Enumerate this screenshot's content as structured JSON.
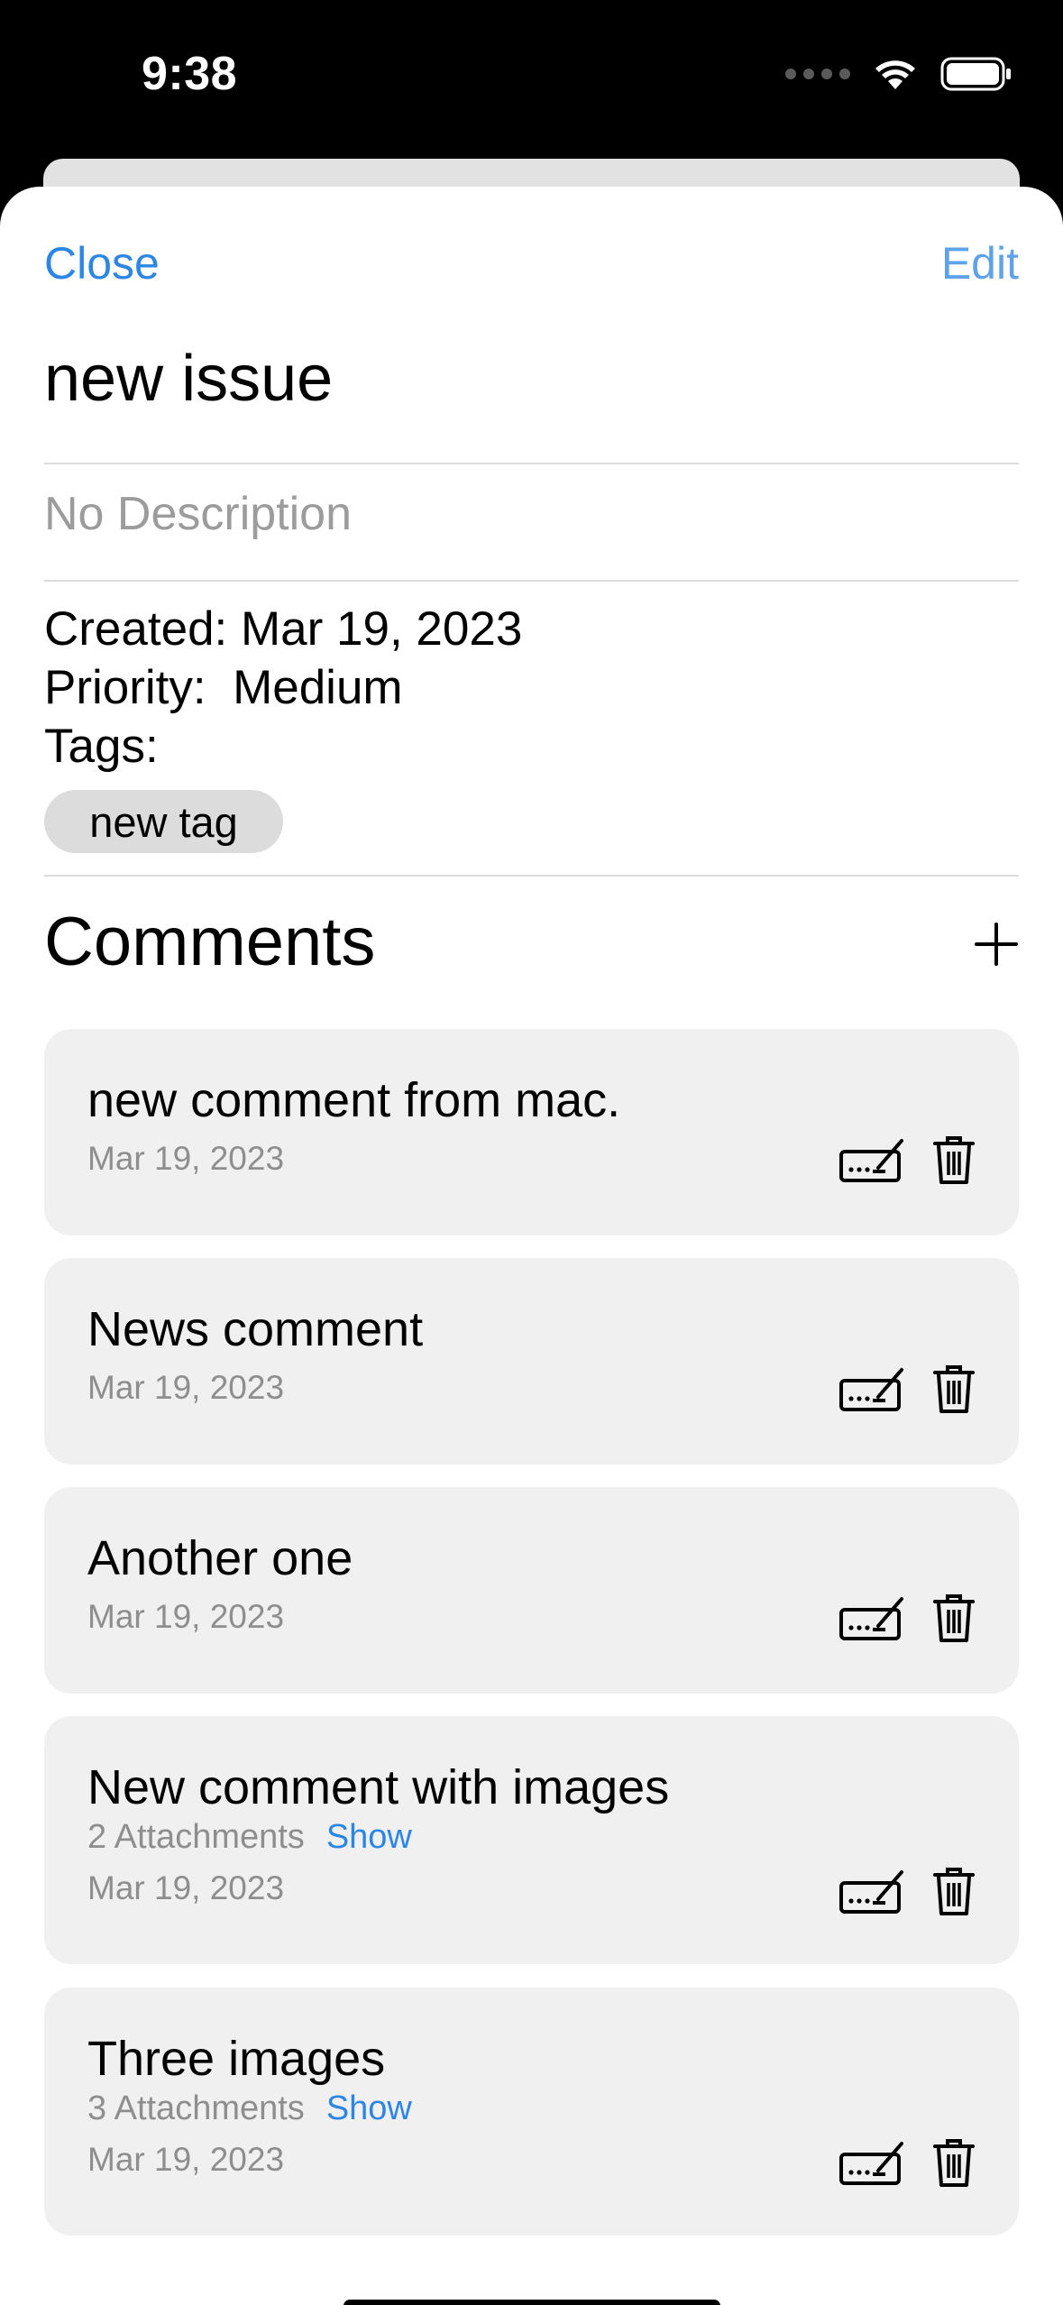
{
  "status_bar": {
    "time": "9:38"
  },
  "nav": {
    "close_label": "Close",
    "edit_label": "Edit"
  },
  "issue": {
    "title": "new issue",
    "description": "No Description",
    "created": "Created: Mar 19, 2023",
    "priority": "Priority:  Medium",
    "tags_label": "Tags:",
    "tags": [
      "new tag"
    ]
  },
  "comments": {
    "heading": "Comments",
    "items": [
      {
        "text": "new comment from mac.",
        "date": "Mar 19, 2023"
      },
      {
        "text": "News comment",
        "date": "Mar 19, 2023"
      },
      {
        "text": "Another one",
        "date": "Mar 19, 2023"
      },
      {
        "text": "New comment with images",
        "attachments": "2 Attachments",
        "show_label": "Show",
        "date": "Mar 19, 2023"
      },
      {
        "text": "Three images",
        "attachments": "3 Attachments",
        "show_label": "Show",
        "date": "Mar 19, 2023"
      }
    ]
  },
  "icons": {
    "signal": "cellular-signal-icon",
    "wifi": "wifi-icon",
    "battery": "battery-icon",
    "add": "plus-icon",
    "edit": "keyboard-pen-icon",
    "delete": "trash-icon"
  },
  "colors": {
    "accent": "#2d86e3",
    "card_bg": "#f0f0f0",
    "tag_bg": "#dcdcdc"
  }
}
